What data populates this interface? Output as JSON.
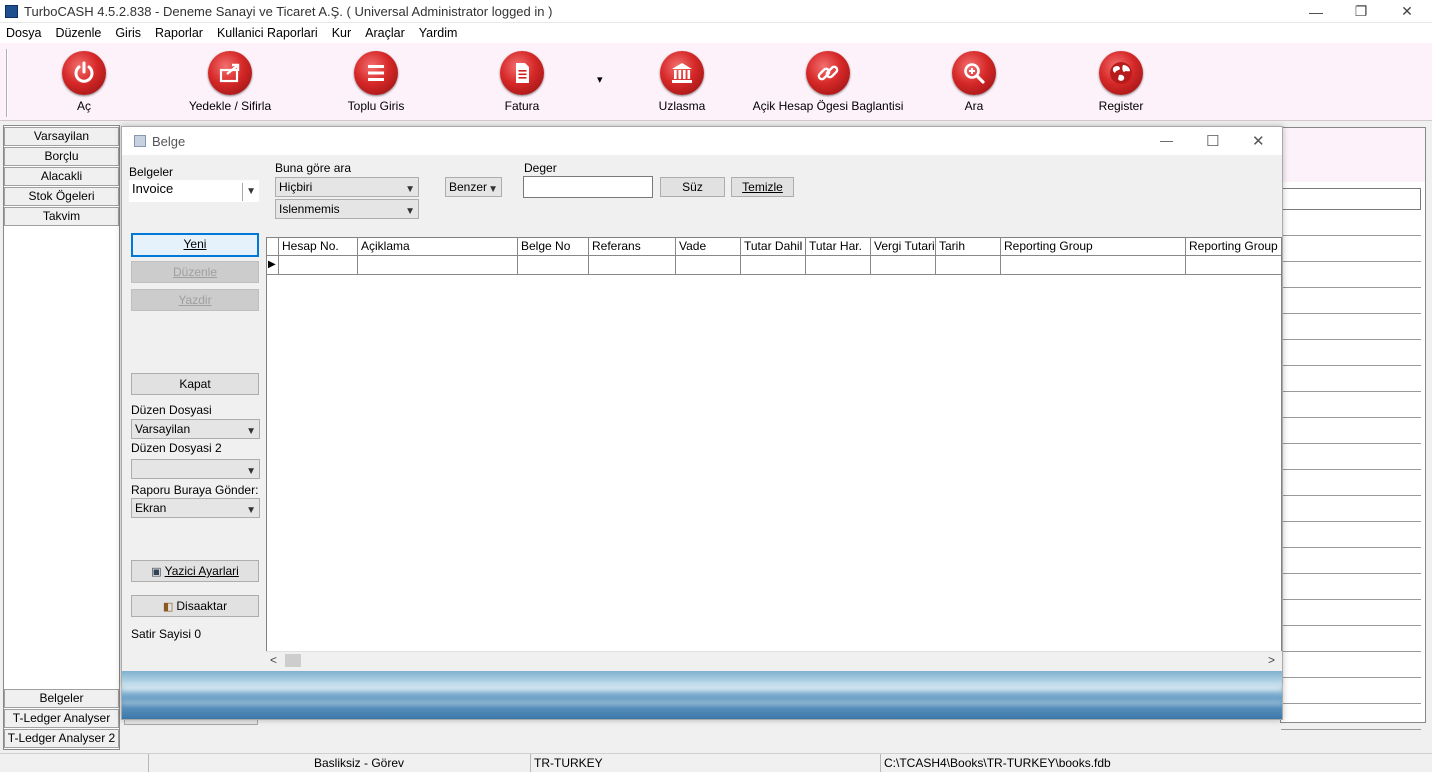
{
  "window": {
    "title": "TurboCASH 4.5.2.838  - Deneme Sanayi ve Ticaret A.Ş. ( Universal Administrator logged in )",
    "minimize": "—",
    "restore": "❐",
    "close": "✕"
  },
  "menu": [
    "Dosya",
    "Düzenle",
    "Giris",
    "Raporlar",
    "Kullanici Raporlari",
    "Kur",
    "Araçlar",
    "Yardim"
  ],
  "toolbar": {
    "ac": "Aç",
    "yedekle": "Yedekle / Sifirla",
    "toplu": "Toplu Giris",
    "fatura": "Fatura",
    "dropdown": "▾",
    "uzlasma": "Uzlasma",
    "acik_hesap": "Açik Hesap Ögesi Baglantisi",
    "ara": "Ara",
    "register": "Register"
  },
  "left_panel": {
    "top": [
      "Varsayilan",
      "Borçlu",
      "Alacakli",
      "Stok Ögeleri",
      "Takvim"
    ],
    "bottom": [
      "Belgeler",
      "T-Ledger Analyser",
      "T-Ledger Analyser 2"
    ]
  },
  "dialog": {
    "title": "Belge",
    "min": "—",
    "max": "☐",
    "close": "✕",
    "belgeler_label": "Belgeler",
    "belgeler_value": "Invoice",
    "buna_gore_ara_label": "Buna göre ara",
    "search_field_value": "Hiçbiri",
    "status_value": "Islenmemis",
    "match_value": "Benzer",
    "deger_label": "Deger",
    "deger_value": "",
    "suz": "Süz",
    "temizle": "Temizle",
    "yeni": "Yeni",
    "duzenle": "Düzenle",
    "yazdir": "Yazdir",
    "kapat": "Kapat",
    "duzen_dosyasi_label": "Düzen Dosyasi",
    "duzen_dosyasi_value": "Varsayilan",
    "duzen_dosyasi2_label": "Düzen Dosyasi 2",
    "duzen_dosyasi2_value": "",
    "rapor_label": "Raporu Buraya Gönder:",
    "rapor_value": "Ekran",
    "yazici": "Yazici Ayarlari",
    "disaaktar": "Disaaktar",
    "satir_sayisi": "Satir Sayisi 0",
    "columns": [
      "Hesap No.",
      "Açiklama",
      "Belge No",
      "Referans",
      "Vade",
      "Tutar Dahil",
      "Tutar Har.",
      "Vergi Tutari",
      "Tarih",
      "Reporting Group",
      "Reporting Group"
    ],
    "row_indicator": "▶",
    "scroll_left": "<",
    "scroll_right": ">"
  },
  "statusbar": {
    "task": "Basliksiz - Görev",
    "locale": "TR-TURKEY",
    "path": "C:\\TCASH4\\Books\\TR-TURKEY\\books.fdb"
  },
  "colors": {
    "toolbar_bg": "#fdf2fa",
    "button_red": "#d62828",
    "default_button_border": "#0078d7"
  }
}
